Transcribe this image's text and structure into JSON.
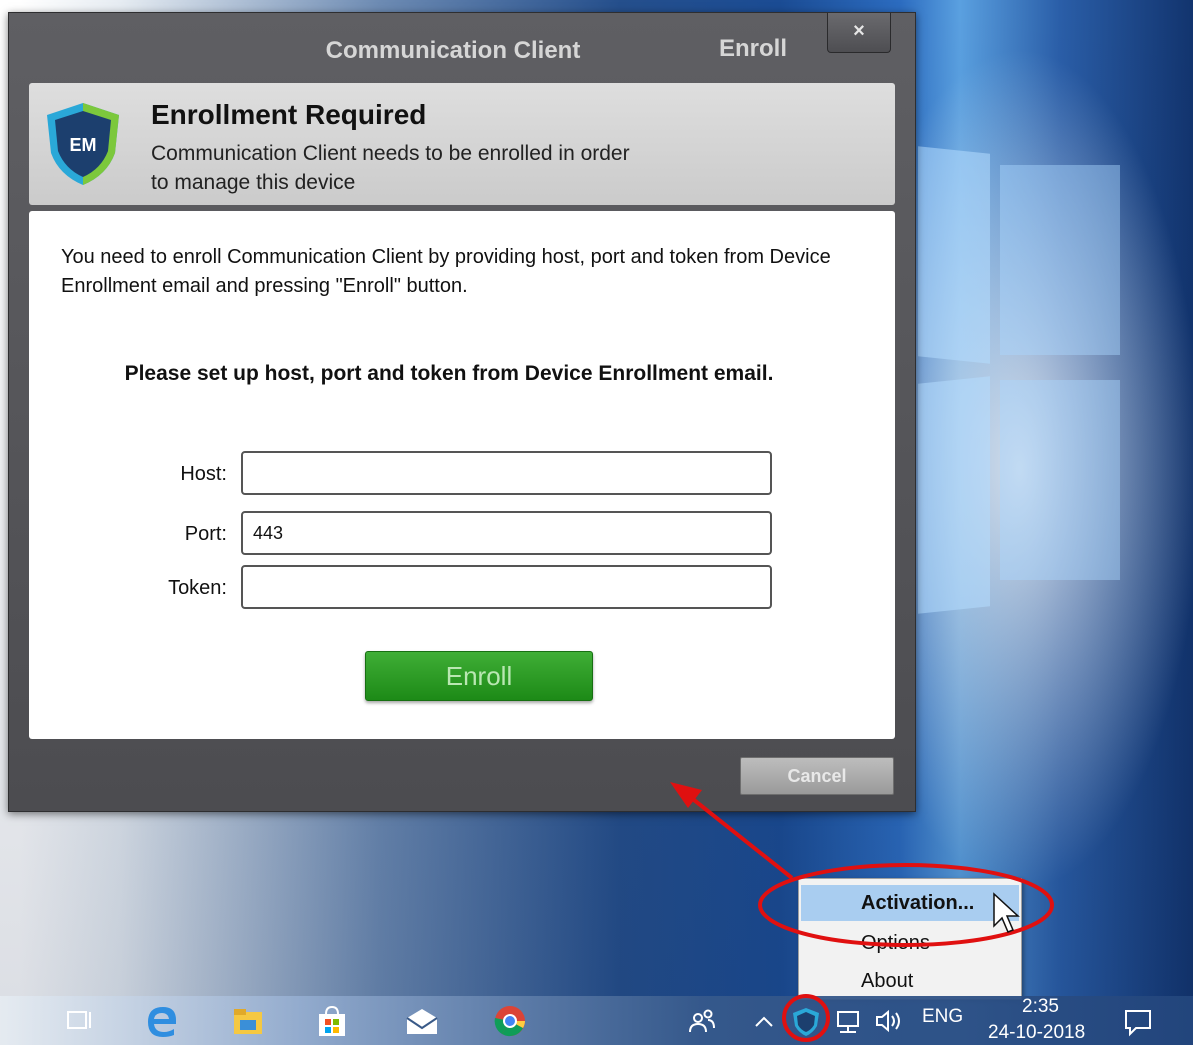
{
  "window": {
    "title": "Communication Client",
    "title_action": "Enroll",
    "close_glyph": "×"
  },
  "header": {
    "logo_text": "EM",
    "title": "Enrollment Required",
    "description": "Communication Client needs to be enrolled in order to manage this device"
  },
  "content": {
    "intro": "You need to enroll Communication Client by providing host, port and token from Device Enrollment email and pressing \"Enroll\" button.",
    "prompt": "Please set up host, port and token from Device Enrollment email.",
    "fields": {
      "host": {
        "label": "Host:",
        "value": ""
      },
      "port": {
        "label": "Port:",
        "value": "443"
      },
      "token": {
        "label": "Token:",
        "value": ""
      }
    },
    "enroll_label": "Enroll"
  },
  "footer": {
    "cancel_label": "Cancel"
  },
  "context_menu": {
    "items": [
      {
        "label": "Activation...",
        "highlighted": true
      },
      {
        "label": "Options",
        "highlighted": false
      },
      {
        "label": "About",
        "highlighted": false
      }
    ]
  },
  "taskbar": {
    "icons": [
      "task-view-icon",
      "edge-icon",
      "file-explorer-icon",
      "store-icon",
      "mail-icon",
      "chrome-icon"
    ],
    "tray": {
      "icons": [
        "people-icon",
        "chevron-up-icon",
        "em-tray-icon",
        "network-icon",
        "volume-icon",
        "notification-icon"
      ],
      "language": "ENG",
      "time": "2:35",
      "date": "24-10-2018"
    }
  },
  "colors": {
    "enroll_green": "#2a9a22",
    "annotation_red": "#e01010",
    "menu_highlight": "#a9cdf0"
  }
}
